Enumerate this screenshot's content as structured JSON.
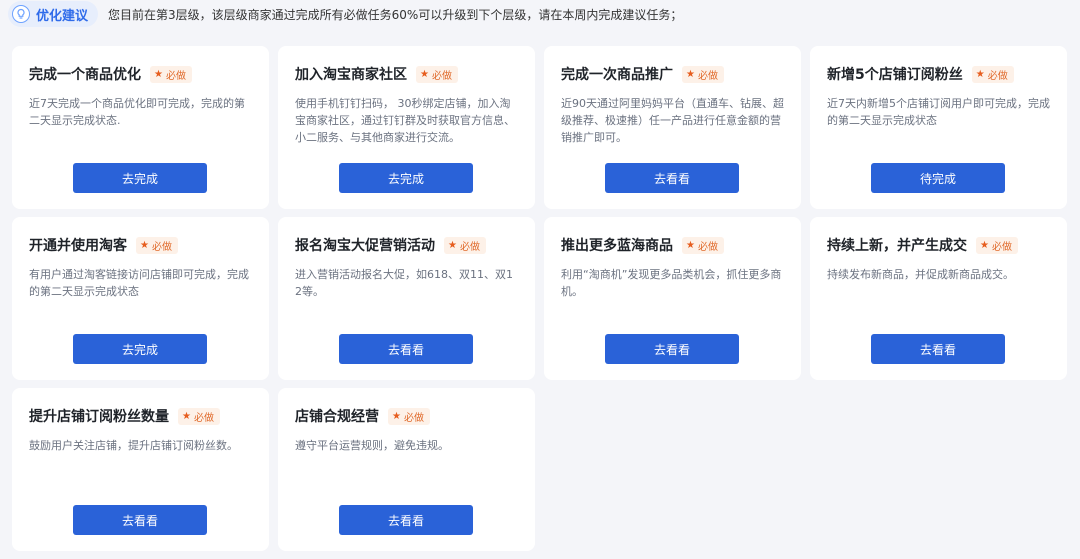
{
  "header": {
    "tag_label": "优化建议",
    "notice": "您目前在第3层级，该层级商家通过完成所有必做任务60%可以升级到下个层级，请在本周内完成建议任务；"
  },
  "badge_label": "必做",
  "colors": {
    "primary_button": "#2a62d8",
    "badge_text": "#e06a2b",
    "badge_bg": "#fdf1e8",
    "tag_text": "#2f6bea"
  },
  "cards": [
    {
      "title": "完成一个商品优化",
      "desc": "近7天完成一个商品优化即可完成，完成的第二天显示完成状态.",
      "button": "去完成"
    },
    {
      "title": "加入淘宝商家社区",
      "desc": "使用手机钉钉扫码， 30秒绑定店铺，加入淘宝商家社区，通过钉钉群及时获取官方信息、小二服务、与其他商家进行交流。",
      "button": "去完成"
    },
    {
      "title": "完成一次商品推广",
      "desc": "近90天通过阿里妈妈平台（直通车、钻展、超级推荐、极速推）任一产品进行任意金额的营销推广即可。",
      "button": "去看看"
    },
    {
      "title": "新增5个店铺订阅粉丝",
      "desc": "近7天内新增5个店铺订阅用户即可完成，完成的第二天显示完成状态",
      "button": "待完成"
    },
    {
      "title": "开通并使用淘客",
      "desc": "有用户通过淘客链接访问店铺即可完成，完成的第二天显示完成状态",
      "button": "去完成"
    },
    {
      "title": "报名淘宝大促营销活动",
      "desc": "进入营销活动报名大促，如618、双11、双12等。",
      "button": "去看看"
    },
    {
      "title": "推出更多蓝海商品",
      "desc": "利用“淘商机”发现更多品类机会，抓住更多商机。",
      "button": "去看看"
    },
    {
      "title": "持续上新，并产生成交",
      "desc": "持续发布新商品，并促成新商品成交。",
      "button": "去看看"
    },
    {
      "title": "提升店铺订阅粉丝数量",
      "desc": "鼓励用户关注店铺，提升店铺订阅粉丝数。",
      "button": "去看看"
    },
    {
      "title": "店铺合规经营",
      "desc": "遵守平台运营规则，避免违规。",
      "button": "去看看"
    }
  ]
}
